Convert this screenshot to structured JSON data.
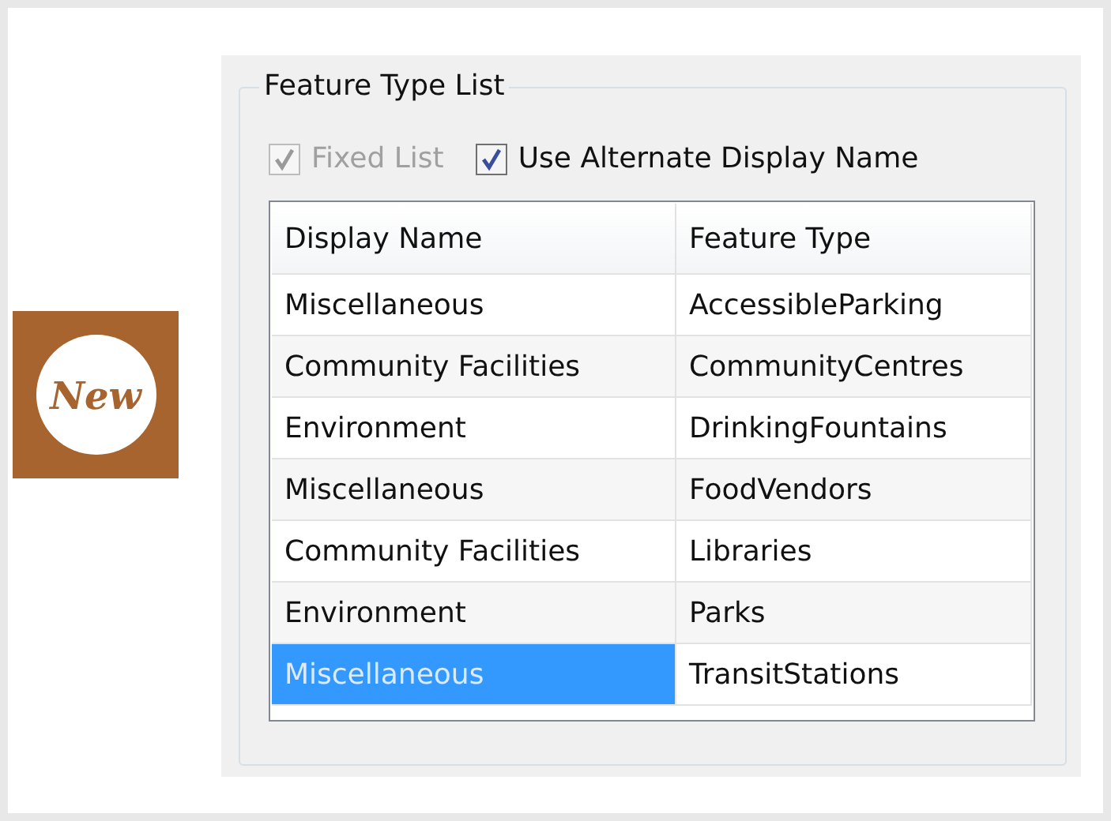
{
  "badge": {
    "label": "New"
  },
  "group": {
    "title": "Feature Type List"
  },
  "checkboxes": [
    {
      "label": "Fixed List",
      "checked": true,
      "disabled": true
    },
    {
      "label": "Use Alternate Display Name",
      "checked": true,
      "disabled": false
    }
  ],
  "table": {
    "columns": [
      "Display Name",
      "Feature Type"
    ],
    "rows": [
      {
        "cells": [
          "Miscellaneous",
          "AccessibleParking"
        ],
        "selected": false
      },
      {
        "cells": [
          "Community Facilities",
          "CommunityCentres"
        ],
        "selected": false
      },
      {
        "cells": [
          "Environment",
          "DrinkingFountains"
        ],
        "selected": false
      },
      {
        "cells": [
          "Miscellaneous",
          "FoodVendors"
        ],
        "selected": false
      },
      {
        "cells": [
          "Community Facilities",
          "Libraries"
        ],
        "selected": false
      },
      {
        "cells": [
          "Environment",
          "Parks"
        ],
        "selected": false
      },
      {
        "cells": [
          "Miscellaneous",
          "TransitStations"
        ],
        "selected": true
      }
    ]
  }
}
